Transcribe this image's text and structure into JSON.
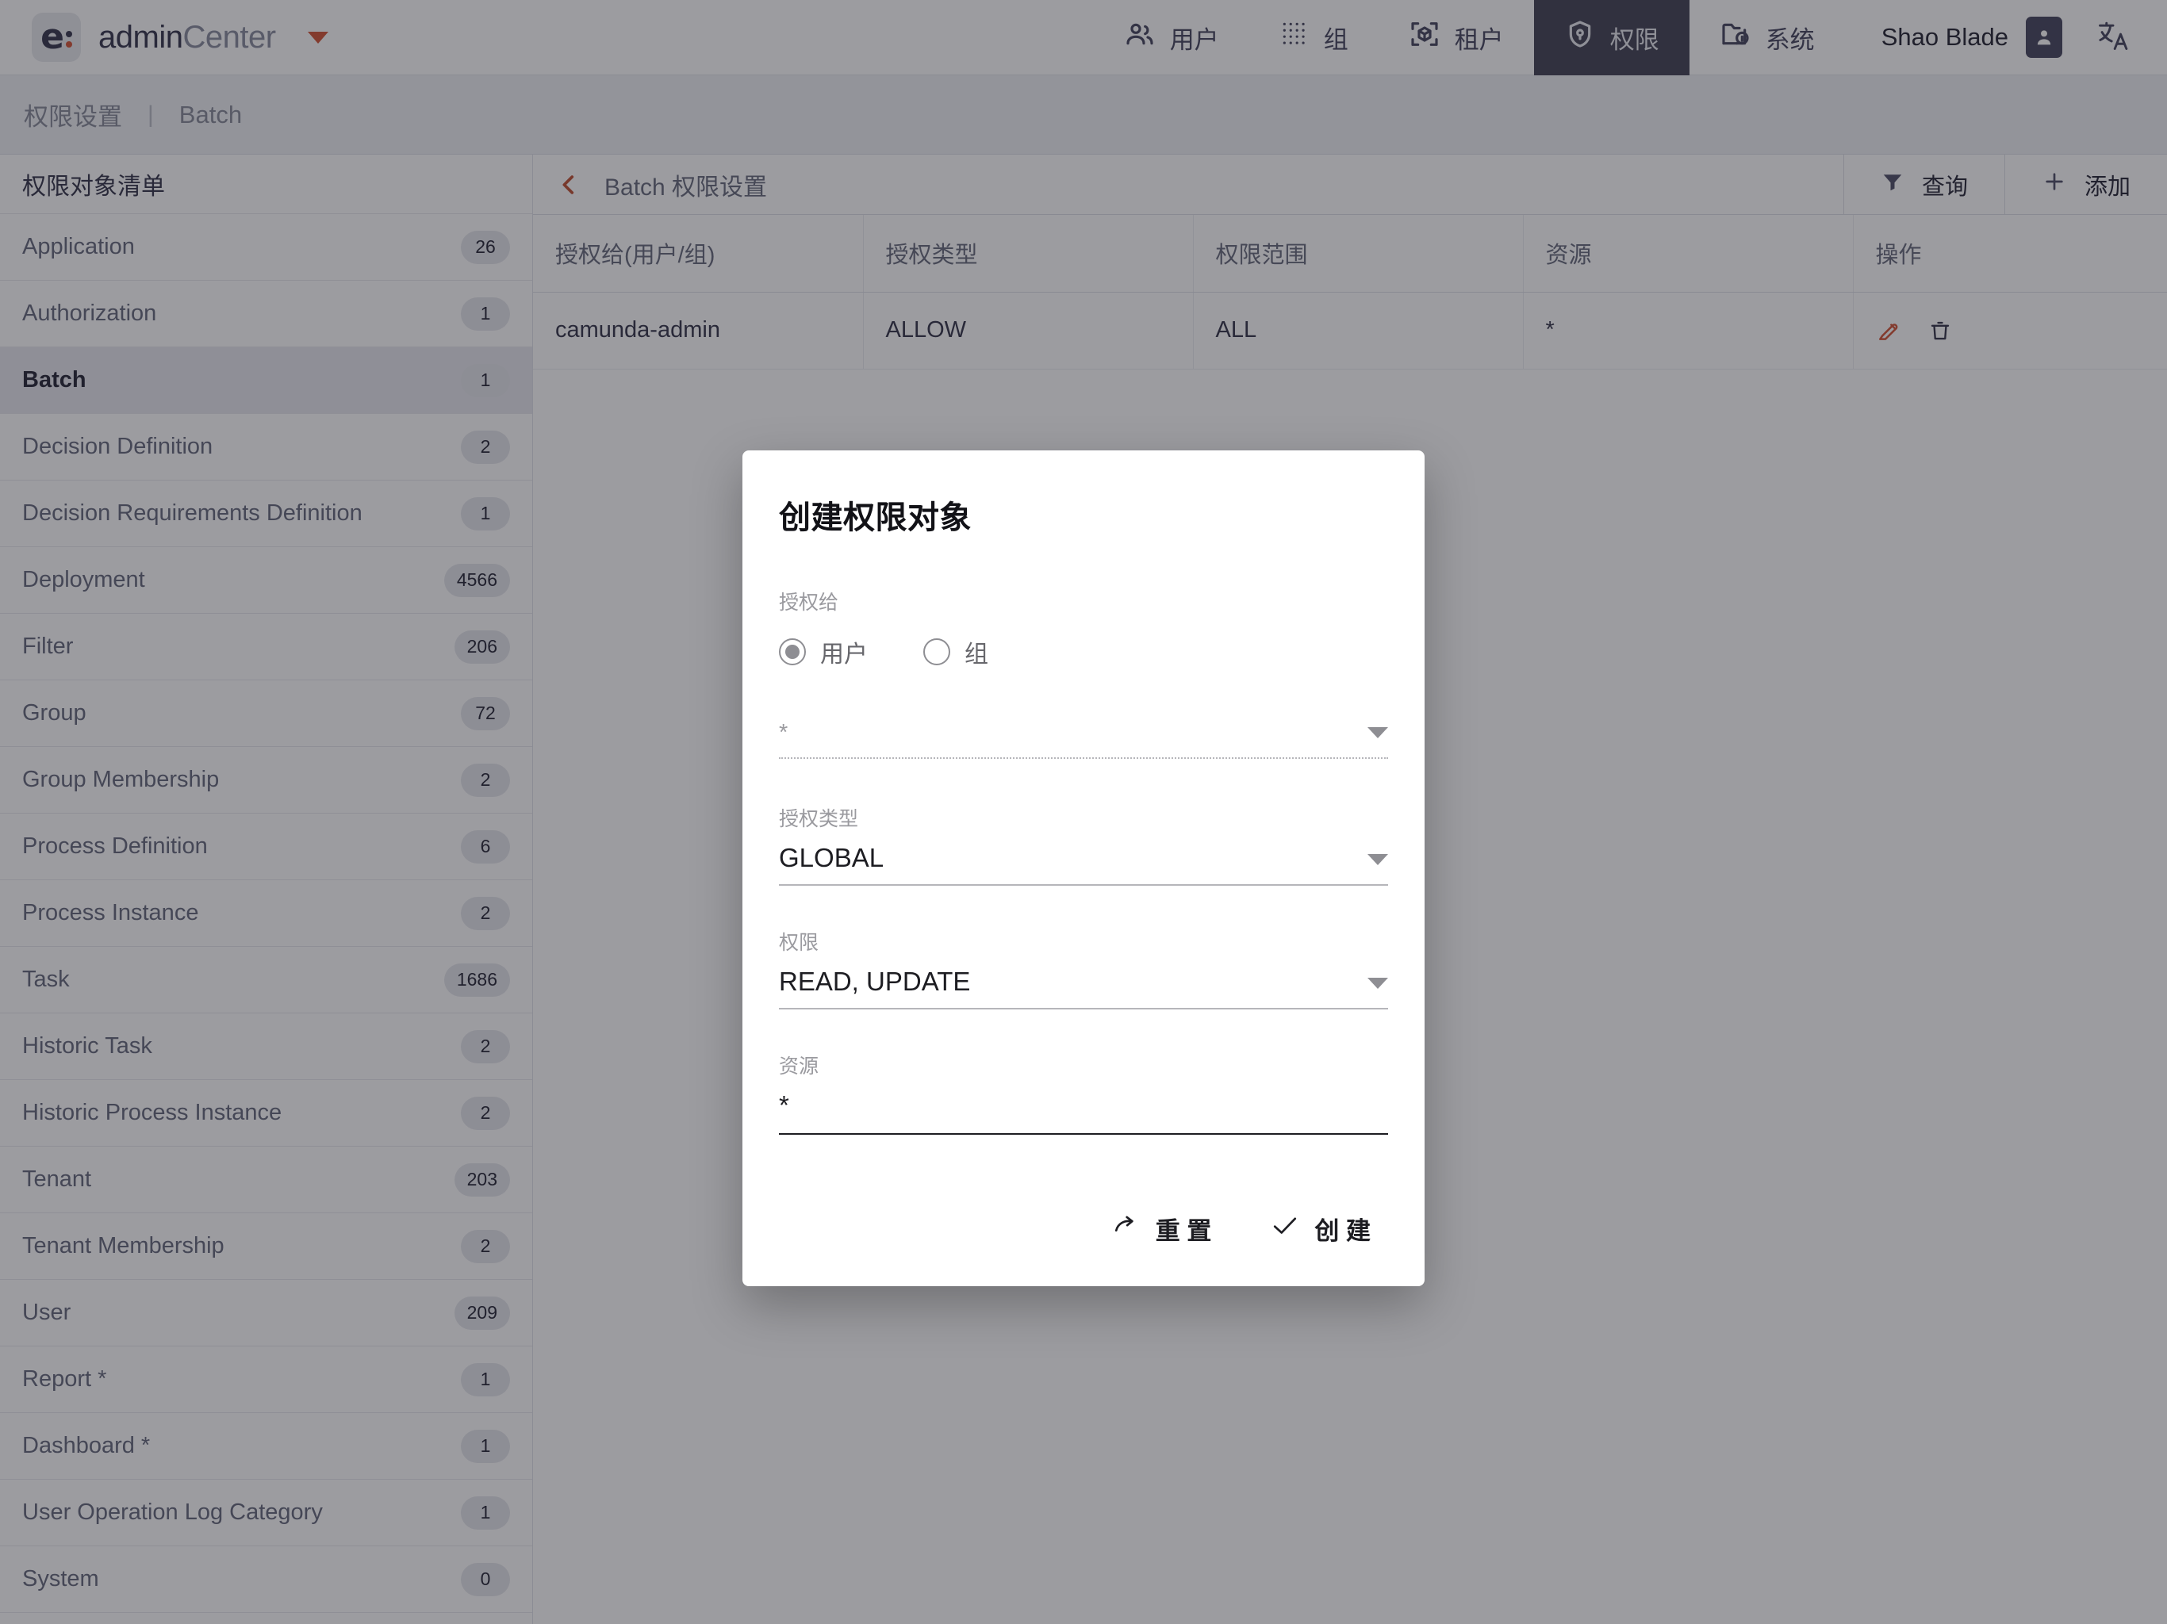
{
  "navbar": {
    "brand_prefix": "admin",
    "brand_suffix": "Center",
    "brand_logo_letter": "e",
    "tabs": [
      {
        "label": "用户",
        "icon": "users-icon",
        "active": false
      },
      {
        "label": "组",
        "icon": "grid-dots-icon",
        "active": false
      },
      {
        "label": "租户",
        "icon": "cube-scan-icon",
        "active": false
      },
      {
        "label": "权限",
        "icon": "shield-lock-icon",
        "active": true
      },
      {
        "label": "系统",
        "icon": "folder-info-icon",
        "active": false
      }
    ],
    "user_name": "Shao Blade",
    "avatar_icon": "user-avatar-icon",
    "language_icon": "translate-icon"
  },
  "breadcrumb": {
    "root": "权限设置",
    "separator": "|",
    "current": "Batch"
  },
  "sidebar": {
    "title": "权限对象清单",
    "items": [
      {
        "label": "Application",
        "count": "26",
        "selected": false
      },
      {
        "label": "Authorization",
        "count": "1",
        "selected": false
      },
      {
        "label": "Batch",
        "count": "1",
        "selected": true
      },
      {
        "label": "Decision Definition",
        "count": "2",
        "selected": false
      },
      {
        "label": "Decision Requirements Definition",
        "count": "1",
        "selected": false
      },
      {
        "label": "Deployment",
        "count": "4566",
        "selected": false
      },
      {
        "label": "Filter",
        "count": "206",
        "selected": false
      },
      {
        "label": "Group",
        "count": "72",
        "selected": false
      },
      {
        "label": "Group Membership",
        "count": "2",
        "selected": false
      },
      {
        "label": "Process Definition",
        "count": "6",
        "selected": false
      },
      {
        "label": "Process Instance",
        "count": "2",
        "selected": false
      },
      {
        "label": "Task",
        "count": "1686",
        "selected": false
      },
      {
        "label": "Historic Task",
        "count": "2",
        "selected": false
      },
      {
        "label": "Historic Process Instance",
        "count": "2",
        "selected": false
      },
      {
        "label": "Tenant",
        "count": "203",
        "selected": false
      },
      {
        "label": "Tenant Membership",
        "count": "2",
        "selected": false
      },
      {
        "label": "User",
        "count": "209",
        "selected": false
      },
      {
        "label": "Report *",
        "count": "1",
        "selected": false
      },
      {
        "label": "Dashboard *",
        "count": "1",
        "selected": false
      },
      {
        "label": "User Operation Log Category",
        "count": "1",
        "selected": false
      },
      {
        "label": "System",
        "count": "0",
        "selected": false
      }
    ]
  },
  "main": {
    "back_icon": "chevron-left-icon",
    "title": "Batch 权限设置",
    "filter_button": "查询",
    "filter_icon": "funnel-icon",
    "add_button": "添加",
    "add_icon": "plus-icon",
    "table": {
      "columns": [
        "授权给(用户/组)",
        "授权类型",
        "权限范围",
        "资源",
        "操作"
      ],
      "rows": [
        {
          "grantee": "camunda-admin",
          "type": "ALLOW",
          "scope": "ALL",
          "resource": "*",
          "edit_icon": "edit-pencil-icon",
          "delete_icon": "trash-icon"
        }
      ]
    }
  },
  "modal": {
    "title": "创建权限对象",
    "grant_to_label": "授权给",
    "radio_user": "用户",
    "radio_group": "组",
    "radio_selected": "用户",
    "identity_placeholder": "*",
    "identity_value": "",
    "auth_type_label": "授权类型",
    "auth_type_value": "GLOBAL",
    "permissions_label": "权限",
    "permissions_value": "READ, UPDATE",
    "resource_label": "资源",
    "resource_value": "*",
    "reset_button": "重 置",
    "reset_icon": "redo-arrow-icon",
    "create_button": "创 建",
    "create_icon": "check-icon"
  },
  "colors": {
    "accent_orange": "#d4593c",
    "nav_active_bg": "#484859",
    "brand_dark": "#3b3b52",
    "edit_icon": "#d4593c",
    "scrim": "rgba(20,20,28,0.42)"
  }
}
